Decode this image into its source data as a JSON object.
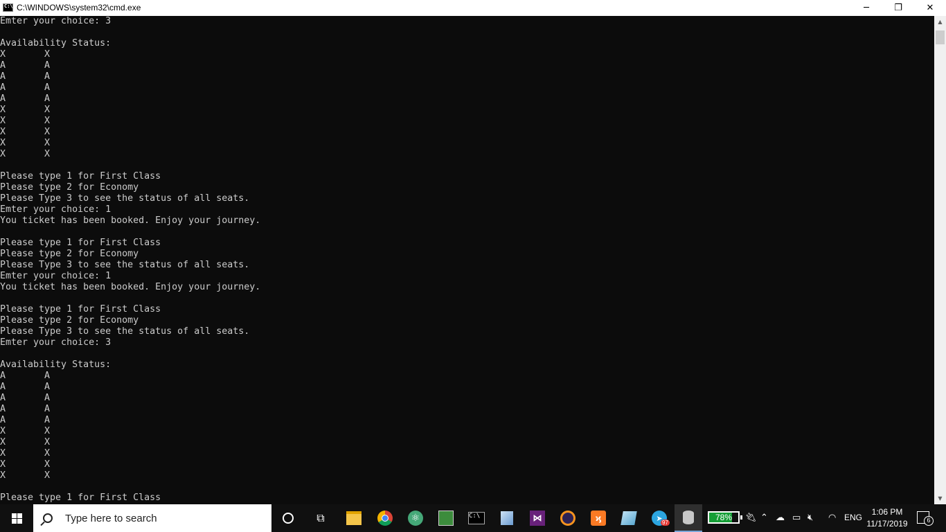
{
  "window": {
    "title": "C:\\WINDOWS\\system32\\cmd.exe",
    "minimize_glyph": "─",
    "restore_glyph": "❐",
    "close_glyph": "✕"
  },
  "console": {
    "lines": [
      "Emter your choice: 3",
      "",
      "Availability Status:",
      "X       X",
      "A       A",
      "A       A",
      "A       A",
      "A       A",
      "X       X",
      "X       X",
      "X       X",
      "X       X",
      "X       X",
      "",
      "Please type 1 for First Class",
      "Please type 2 for Economy",
      "Please Type 3 to see the status of all seats.",
      "Emter your choice: 1",
      "You ticket has been booked. Enjoy your journey.",
      "",
      "Please type 1 for First Class",
      "Please type 2 for Economy",
      "Please Type 3 to see the status of all seats.",
      "Emter your choice: 1",
      "You ticket has been booked. Enjoy your journey.",
      "",
      "Please type 1 for First Class",
      "Please type 2 for Economy",
      "Please Type 3 to see the status of all seats.",
      "Emter your choice: 3",
      "",
      "Availability Status:",
      "A       A",
      "A       A",
      "A       A",
      "A       A",
      "A       A",
      "X       X",
      "X       X",
      "X       X",
      "X       X",
      "X       X",
      "",
      "Please type 1 for First Class"
    ],
    "text_color": "#cccccc",
    "background": "#0c0c0c"
  },
  "scrollbar": {
    "up_glyph": "▲",
    "down_glyph": "▼"
  },
  "taskbar": {
    "search_placeholder": "Type here to search",
    "apps": [
      "cortana",
      "task-view",
      "file-explorer",
      "chrome",
      "atom",
      "chart-app",
      "cmd",
      "cube-app",
      "visual-studio",
      "eclipse",
      "xampp",
      "notepad",
      "telegram",
      "database-app"
    ],
    "telegram_badge": "97",
    "battery_percent": "78%",
    "battery_level": 0.78,
    "language": "ENG",
    "time": "1:06 PM",
    "date": "11/17/2019",
    "notification_count": "6"
  }
}
